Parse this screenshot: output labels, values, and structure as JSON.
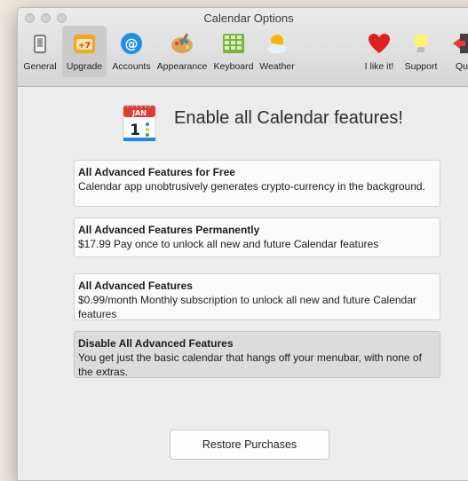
{
  "window": {
    "title": "Calendar Options"
  },
  "toolbar": {
    "items": [
      {
        "label": "General",
        "icon": "phone-icon"
      },
      {
        "label": "Upgrade",
        "icon": "calendar-upgrade-icon",
        "selected": true
      },
      {
        "label": "Accounts",
        "icon": "at-sign-icon"
      },
      {
        "label": "Appearance",
        "icon": "paint-palette-icon"
      },
      {
        "label": "Keyboard",
        "icon": "keyboard-grid-icon"
      },
      {
        "label": "Weather",
        "icon": "sun-cloud-icon"
      },
      {
        "label": "I like it!",
        "icon": "heart-icon"
      },
      {
        "label": "Support",
        "icon": "lightbulb-icon"
      },
      {
        "label": "Quit",
        "icon": "exit-door-icon"
      }
    ]
  },
  "hero": {
    "icon_month": "JAN",
    "icon_day": "1",
    "text": "Enable all Calendar features!"
  },
  "options": [
    {
      "title": "All Advanced Features for Free",
      "desc": "Calendar app unobtrusively generates crypto-currency in the background."
    },
    {
      "title": "All Advanced Features Permanently",
      "desc": "$17.99 Pay once to unlock all new and future Calendar features"
    },
    {
      "title": "All Advanced Features",
      "desc": "$0.99/month Monthly subscription to unlock all new and future Calendar features"
    },
    {
      "title": "Disable All Advanced Features",
      "desc": "You get just the basic calendar that hangs off your menubar, with none of the extras.",
      "selected": true
    }
  ],
  "restore_button": "Restore Purchases",
  "colors": {
    "selected_bg": "#dcdcdc",
    "heart": "#e02020",
    "at_blue": "#1e8df0"
  }
}
